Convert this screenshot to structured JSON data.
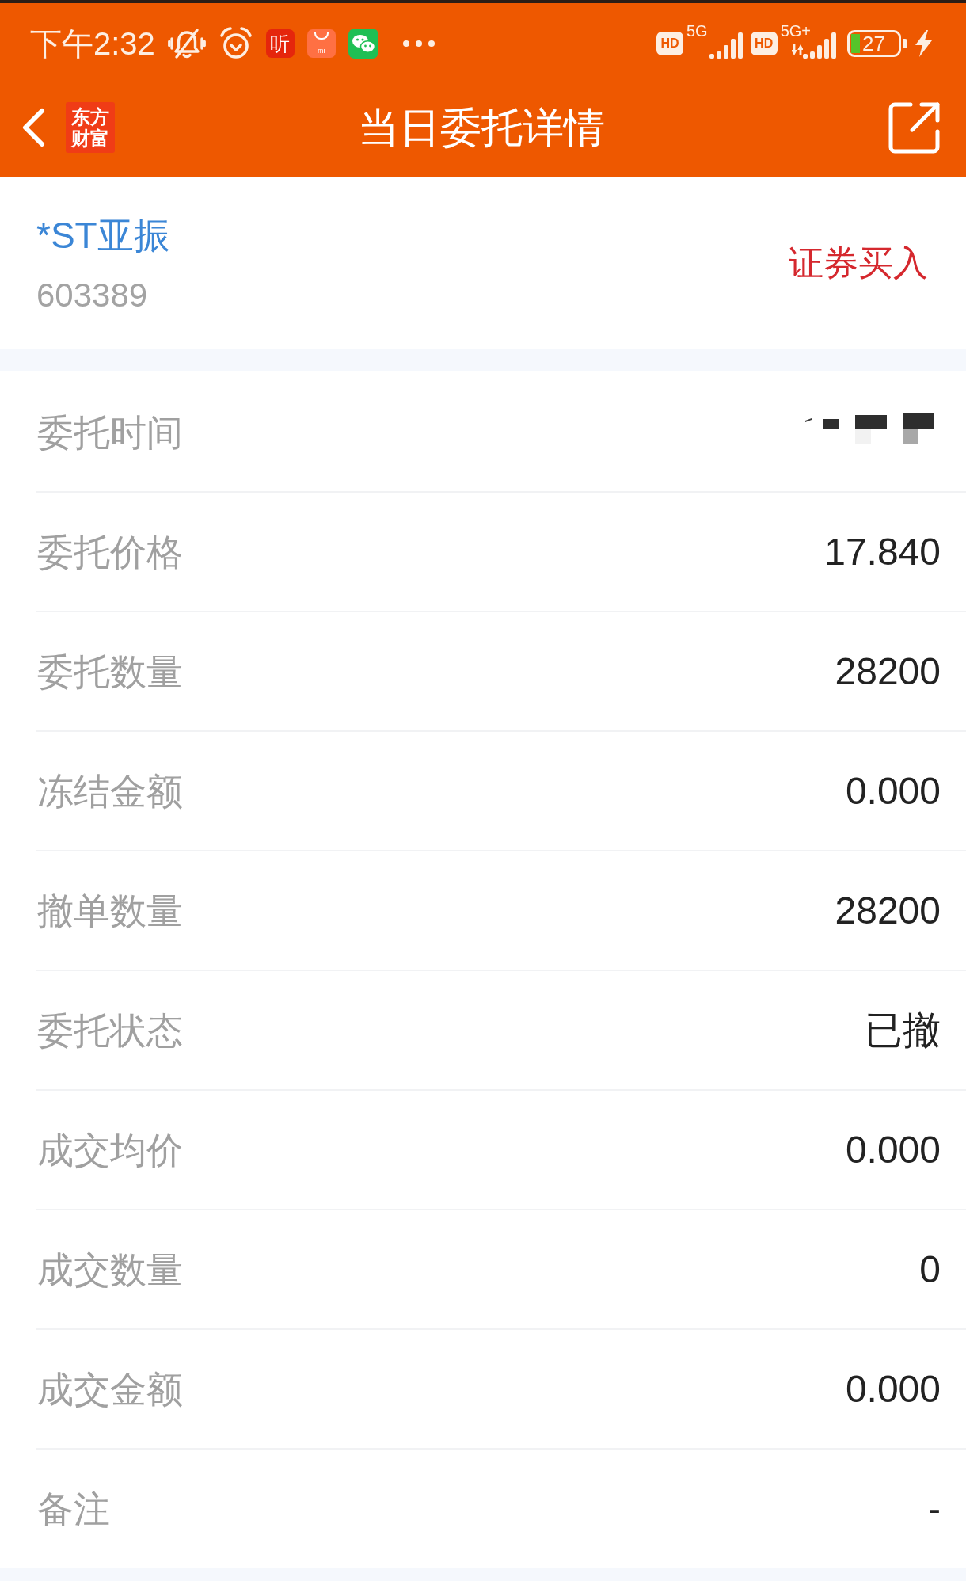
{
  "status_bar": {
    "time": "下午2:32",
    "notifications": [
      {
        "kind": "mute"
      },
      {
        "kind": "alarm"
      },
      {
        "kind": "listen",
        "glyph": "听"
      },
      {
        "kind": "store",
        "glyph": "mi"
      },
      {
        "kind": "chat"
      },
      {
        "kind": "more"
      }
    ],
    "networks": [
      {
        "badge": "HD",
        "type": "5G",
        "data_active": false
      },
      {
        "badge": "HD",
        "type": "5G+",
        "data_active": true
      }
    ],
    "battery": "27"
  },
  "header": {
    "logo": "东方财富",
    "title": "当日委托详情"
  },
  "stock": {
    "name": "*ST亚振",
    "code": "603389",
    "side": "证券买入"
  },
  "rows": [
    {
      "label": "委托时间",
      "redacted": true
    },
    {
      "label": "委托价格",
      "value": "17.840",
      "redacted": false
    },
    {
      "label": "委托数量",
      "value": "28200",
      "redacted": false
    },
    {
      "label": "冻结金额",
      "value": "0.000",
      "redacted": false
    },
    {
      "label": "撤单数量",
      "value": "28200",
      "redacted": false
    },
    {
      "label": "委托状态",
      "value": "已撤",
      "redacted": false
    },
    {
      "label": "成交均价",
      "value": "0.000",
      "redacted": false
    },
    {
      "label": "成交数量",
      "value": "0",
      "redacted": false
    },
    {
      "label": "成交金额",
      "value": "0.000",
      "redacted": false
    },
    {
      "label": "备注",
      "value": "-",
      "redacted": false
    }
  ]
}
